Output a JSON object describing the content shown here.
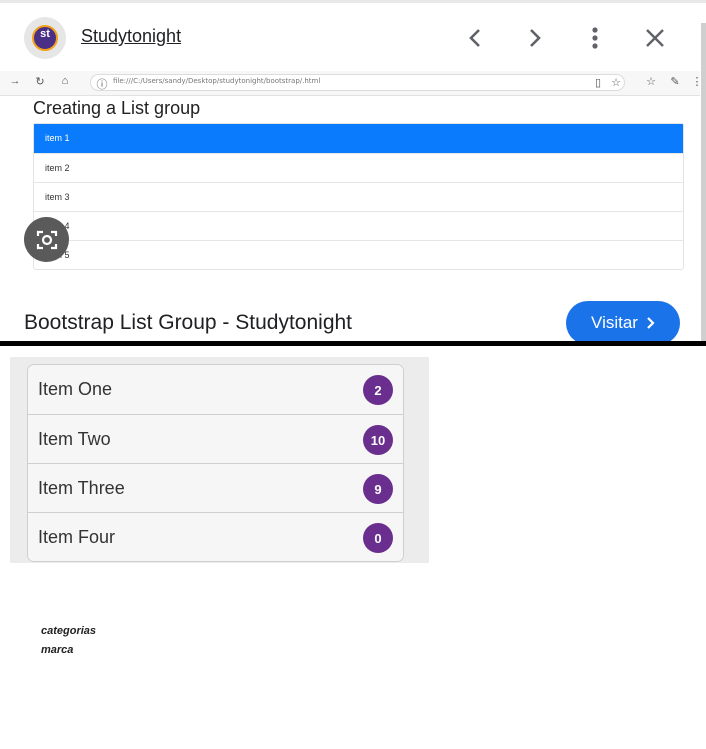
{
  "preview": {
    "site_name": "Studytonight",
    "logo_text": "st",
    "icons": [
      "chevron-left-icon",
      "chevron-right-icon",
      "more-vert-icon",
      "close-icon"
    ],
    "address": "file:///C:/Users/sandy/Desktop/studytonight/bootstrap/.html",
    "page_heading": "Creating a List group",
    "list_items": [
      {
        "label": "item 1",
        "active": true
      },
      {
        "label": "item 2",
        "active": false
      },
      {
        "label": "item 3",
        "active": false
      },
      {
        "label": "item 4",
        "active": false
      },
      {
        "label": "item 5",
        "active": false
      }
    ],
    "card_title": "Bootstrap List Group - Studytonight",
    "visit_label": "Visitar",
    "colors": {
      "active_item": "#0a7bfd",
      "visit_button": "#1a73e8",
      "logo_ring": "#4a2f86"
    }
  },
  "badge_list": {
    "items": [
      {
        "label": "Item One",
        "count": "2"
      },
      {
        "label": "Item Two",
        "count": "10"
      },
      {
        "label": "Item Three",
        "count": "9"
      },
      {
        "label": "Item Four",
        "count": "0"
      }
    ],
    "badge_color": "#6a2f8e"
  },
  "footer_text": {
    "line1": "categorias",
    "line2": "marca"
  }
}
